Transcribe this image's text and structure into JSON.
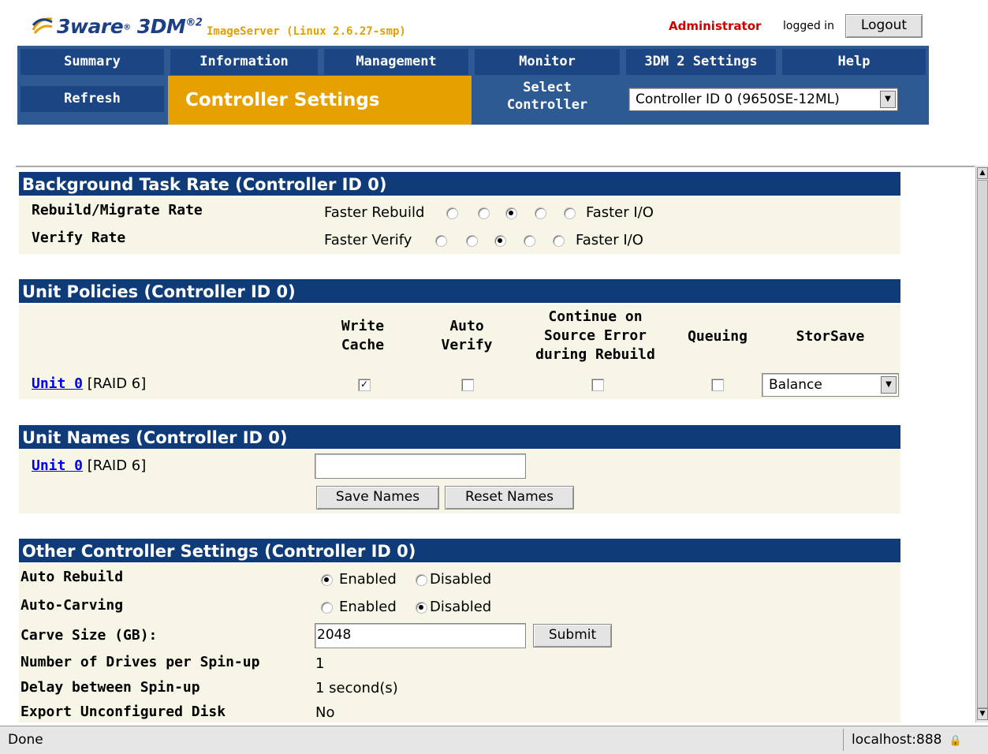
{
  "header": {
    "logo_brand": "3ware",
    "logo_product": "3DM",
    "logo_sup": "®2",
    "server_name": "ImageServer (Linux 2.6.27-smp)",
    "user_role": "Administrator",
    "logged_in_text": "logged in",
    "logout_label": "Logout"
  },
  "nav": {
    "items": [
      "Summary",
      "Information",
      "Management",
      "Monitor",
      "3DM 2 Settings",
      "Help"
    ],
    "refresh_label": "Refresh",
    "current_page": "Controller Settings",
    "select_controller_line1": "Select",
    "select_controller_line2": "Controller",
    "controller_selected": "Controller ID 0 (9650SE-12ML)"
  },
  "background_task": {
    "title": "Background Task Rate (Controller ID 0)",
    "rows": [
      {
        "label": "Rebuild/Migrate Rate",
        "left": "Faster Rebuild",
        "right": "Faster I/O",
        "selected": 3
      },
      {
        "label": "Verify Rate",
        "left": "Faster Verify",
        "right": "Faster I/O",
        "selected": 3
      }
    ]
  },
  "unit_policies": {
    "title": "Unit Policies (Controller ID 0)",
    "col_write_cache": [
      "Write",
      "Cache"
    ],
    "col_auto_verify": [
      "Auto",
      "Verify"
    ],
    "col_continue": [
      "Continue on",
      "Source Error",
      "during Rebuild"
    ],
    "col_queuing": "Queuing",
    "col_storsave": "StorSave",
    "unit_link": "Unit 0",
    "unit_type": "[RAID 6]",
    "write_cache": true,
    "auto_verify": false,
    "continue_on_error": false,
    "queuing": false,
    "storsave_value": "Balance"
  },
  "unit_names": {
    "title": "Unit Names (Controller ID 0)",
    "unit_link": "Unit 0",
    "unit_type": "[RAID 6]",
    "name_value": "",
    "save_label": "Save Names",
    "reset_label": "Reset Names"
  },
  "other_settings": {
    "title": "Other Controller Settings (Controller ID 0)",
    "auto_rebuild_label": "Auto Rebuild",
    "auto_rebuild": "Enabled",
    "auto_carving_label": "Auto-Carving",
    "auto_carving": "Disabled",
    "enabled_label": "Enabled",
    "disabled_label": "Disabled",
    "carve_size_label": "Carve Size (GB):",
    "carve_size_value": "2048",
    "submit_label": "Submit",
    "drives_per_spinup_label": "Number of Drives per Spin-up",
    "drives_per_spinup_value": "1",
    "delay_spinup_label": "Delay between Spin-up",
    "delay_spinup_value": "1 second(s)",
    "export_disk_label": "Export Unconfigured Disk",
    "export_disk_value": "No"
  },
  "status_bar": {
    "status": "Done",
    "host": "localhost:888"
  }
}
